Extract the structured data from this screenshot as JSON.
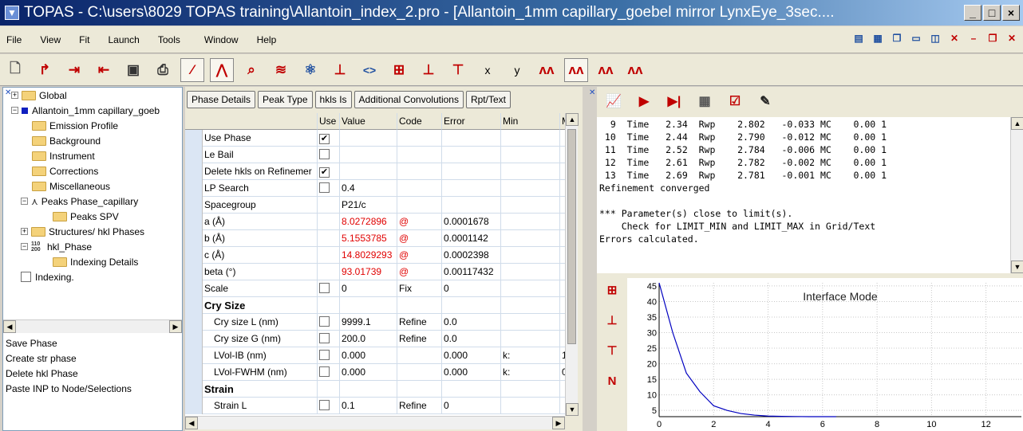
{
  "title": "TOPAS - C:\\users\\8029 TOPAS training\\Allantoin_index_2.pro - [Allantoin_1mm capillary_goebel mirror LynxEye_3sec....",
  "window_buttons": [
    "_",
    "□",
    "×"
  ],
  "menu": [
    "File",
    "View",
    "Fit",
    "Launch",
    "Tools",
    "Window",
    "Help"
  ],
  "toolbar_icons": [
    "new-file",
    "open-file",
    "load-phase",
    "save-phase",
    "save-file",
    "print",
    "magic-wand",
    "peak-fit",
    "zoom",
    "hkl",
    "structure",
    "indexing",
    "axes",
    "code-brackets",
    "indexing-grid",
    "peak-single",
    "peak-multi",
    "x",
    "y",
    "plot-a",
    "plot-b",
    "plot-c",
    "plot-d"
  ],
  "toolbar_labels": {
    "x": "x",
    "y": "y",
    "code": "<>"
  },
  "tree": [
    {
      "label": "Global",
      "indent": 0,
      "kind": "folder",
      "toggle": "+"
    },
    {
      "label": "Allantoin_1mm capillary_goeb",
      "indent": 0,
      "kind": "range",
      "toggle": "-"
    },
    {
      "label": "Emission Profile",
      "indent": 1,
      "kind": "folder"
    },
    {
      "label": "Background",
      "indent": 1,
      "kind": "folder"
    },
    {
      "label": "Instrument",
      "indent": 1,
      "kind": "folder"
    },
    {
      "label": "Corrections",
      "indent": 1,
      "kind": "folder"
    },
    {
      "label": "Miscellaneous",
      "indent": 1,
      "kind": "folder"
    },
    {
      "label": "Peaks Phase_capillary",
      "indent": 1,
      "kind": "peaks",
      "toggle": "-"
    },
    {
      "label": "Peaks SPV",
      "indent": 2,
      "kind": "folder"
    },
    {
      "label": "Structures/ hkl Phases",
      "indent": 1,
      "kind": "folder",
      "toggle": "+"
    },
    {
      "label": "hkl_Phase",
      "indent": 1,
      "kind": "hkl",
      "toggle": "-",
      "icon_text": "110 200"
    },
    {
      "label": "Indexing Details",
      "indent": 2,
      "kind": "folder"
    },
    {
      "label": "Indexing.",
      "indent": 0,
      "kind": "checkbox"
    }
  ],
  "actions": [
    "Save Phase",
    "Create str phase",
    "Delete hkl Phase",
    "Paste INP to Node/Selections"
  ],
  "phase_buttons": [
    "Phase Details",
    "Peak Type",
    "hkls Is",
    "Additional Convolutions",
    "Rpt/Text"
  ],
  "grid": {
    "headers": [
      "",
      "Use",
      "Value",
      "Code",
      "Error",
      "Min",
      "M"
    ],
    "rows": [
      {
        "label": "Use Phase",
        "use": "✔",
        "value": "",
        "code": "",
        "error": "",
        "min": "",
        "max": "",
        "checkbox": true
      },
      {
        "label": "Le Bail",
        "use": "",
        "value": "",
        "code": "",
        "error": "",
        "min": "",
        "max": "",
        "checkbox": true
      },
      {
        "label": "Delete hkls on Refinemer",
        "use": "✔",
        "value": "",
        "code": "",
        "error": "",
        "min": "",
        "max": "",
        "checkbox": true
      },
      {
        "label": "LP Search",
        "use": "",
        "value": "0.4",
        "code": "",
        "error": "",
        "min": "",
        "max": "",
        "checkbox": true
      },
      {
        "label": "Spacegroup",
        "use": "",
        "value": "P21/c",
        "code": "",
        "error": "",
        "min": "",
        "max": "",
        "checkbox": false
      },
      {
        "label": "a (Å)",
        "use": "",
        "value": "8.0272896",
        "code": "@",
        "error": "0.0001678",
        "min": "",
        "max": "",
        "checkbox": false,
        "red": true
      },
      {
        "label": "b (Å)",
        "use": "",
        "value": "5.1553785",
        "code": "@",
        "error": "0.0001142",
        "min": "",
        "max": "",
        "checkbox": false,
        "red": true
      },
      {
        "label": "c (Å)",
        "use": "",
        "value": "14.8029293",
        "code": "@",
        "error": "0.0002398",
        "min": "",
        "max": "",
        "checkbox": false,
        "red": true
      },
      {
        "label": "beta (°)",
        "use": "",
        "value": "93.01739",
        "code": "@",
        "error": "0.00117432",
        "min": "",
        "max": "",
        "checkbox": false,
        "red": true
      },
      {
        "label": "Scale",
        "use": "",
        "value": "0",
        "code": "Fix",
        "error": "0",
        "min": "",
        "max": "",
        "checkbox": true
      },
      {
        "label": "Cry Size",
        "use": "",
        "value": "",
        "code": "",
        "error": "",
        "min": "",
        "max": "",
        "checkbox": false,
        "section": true
      },
      {
        "label": "Cry size L (nm)",
        "use": "",
        "value": "9999.1",
        "code": "Refine",
        "error": "0.0",
        "min": "",
        "max": "",
        "checkbox": true,
        "sub": true
      },
      {
        "label": "Cry size G (nm)",
        "use": "",
        "value": "200.0",
        "code": "Refine",
        "error": "0.0",
        "min": "",
        "max": "",
        "checkbox": true,
        "sub": true
      },
      {
        "label": "LVol-IB (nm)",
        "use": "",
        "value": "0.000",
        "code": "",
        "error": "0.000",
        "min": "k:",
        "max": "1",
        "checkbox": true,
        "sub": true
      },
      {
        "label": "LVol-FWHM (nm)",
        "use": "",
        "value": "0.000",
        "code": "",
        "error": "0.000",
        "min": "k:",
        "max": "0",
        "checkbox": true,
        "sub": true
      },
      {
        "label": "Strain",
        "use": "",
        "value": "",
        "code": "",
        "error": "",
        "min": "",
        "max": "",
        "checkbox": false,
        "section": true
      },
      {
        "label": "Strain L",
        "use": "",
        "value": "0.1",
        "code": "Refine",
        "error": "0",
        "min": "",
        "max": "",
        "checkbox": true,
        "sub": true
      }
    ]
  },
  "output_lines": [
    "  9  Time   2.34  Rwp    2.802   -0.033 MC    0.00 1",
    " 10  Time   2.44  Rwp    2.790   -0.012 MC    0.00 1",
    " 11  Time   2.52  Rwp    2.784   -0.006 MC    0.00 1",
    " 12  Time   2.61  Rwp    2.782   -0.002 MC    0.00 1",
    " 13  Time   2.69  Rwp    2.781   -0.001 MC    0.00 1",
    "Refinement converged",
    "",
    "*** Parameter(s) close to limit(s).",
    "    Check for LIMIT_MIN and LIMIT_MAX in Grid/Text",
    "Errors calculated."
  ],
  "chart_data": {
    "type": "line",
    "title": "Interface Mode",
    "x": [
      0,
      0.5,
      1,
      1.5,
      2,
      2.5,
      3,
      3.5,
      4,
      4.5,
      5,
      5.5,
      6,
      6.5
    ],
    "series": [
      {
        "values": [
          46,
          30,
          17,
          11,
          6.5,
          5,
          4,
          3.5,
          3.2,
          3.1,
          3.05,
          3.0,
          3.0,
          3.0
        ]
      }
    ],
    "xlim": [
      0,
      13.3
    ],
    "ylim": [
      3,
      46
    ],
    "xticks": [
      0,
      2,
      4,
      6,
      8,
      10,
      12
    ],
    "yticks": [
      5,
      10,
      15,
      20,
      25,
      30,
      35,
      40,
      45
    ],
    "line_color": "#0000c0",
    "grid": true
  },
  "colors": {
    "title_start": "#0a246a",
    "error_red": "#e00000",
    "row_header": "#dbe6f4"
  }
}
